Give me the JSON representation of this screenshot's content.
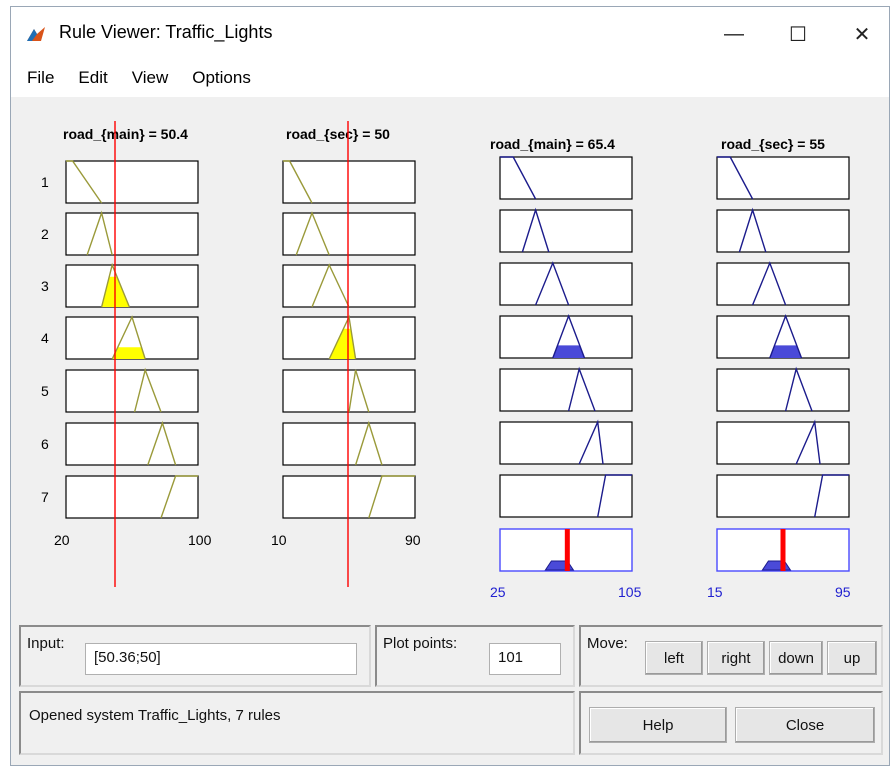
{
  "window": {
    "title": "Rule Viewer: Traffic_Lights",
    "controls": {
      "minimize": "—",
      "maximize": "☐",
      "close": "✕"
    }
  },
  "menu": [
    "File",
    "Edit",
    "View",
    "Options"
  ],
  "inputs": [
    {
      "label": "road_{main} = 50.4",
      "range_min": "20",
      "range_max": "100"
    },
    {
      "label": "road_{sec} = 50",
      "range_min": "10",
      "range_max": "90"
    }
  ],
  "outputs": [
    {
      "label": "road_{main} = 65.4",
      "range_min": "25",
      "range_max": "105"
    },
    {
      "label": "road_{sec} = 55",
      "range_min": "15",
      "range_max": "95"
    }
  ],
  "rule_numbers": [
    "1",
    "2",
    "3",
    "4",
    "5",
    "6",
    "7"
  ],
  "colors": {
    "input_mf": "#9a9a3a",
    "input_fill": "#ffff00",
    "output_mf": "#1c1c8c",
    "output_fill": "#4a4ad8",
    "indicator": "#ff0000",
    "axis_label_blue": "#2020d0"
  },
  "controls": {
    "input_label": "Input:",
    "input_value": "[50.36;50]",
    "plot_points_label": "Plot points:",
    "plot_points_value": "101",
    "move_label": "Move:",
    "move_buttons": [
      "left",
      "right",
      "down",
      "up"
    ],
    "status": "Opened system Traffic_Lights, 7 rules",
    "help_label": "Help",
    "close_label": "Close"
  }
}
